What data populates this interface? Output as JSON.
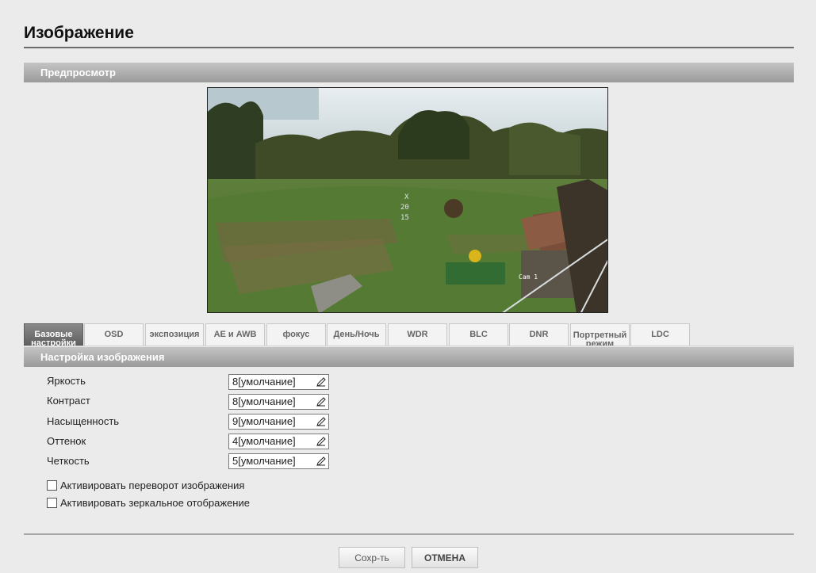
{
  "page": {
    "title": "Изображение"
  },
  "preview": {
    "section_title": "Предпросмотр",
    "overlay_text": "Cam 1"
  },
  "tabs": [
    {
      "label": "Базовые настройки",
      "active": true
    },
    {
      "label": "OSD",
      "active": false
    },
    {
      "label": "экспозиция",
      "active": false
    },
    {
      "label": "AE и AWB",
      "active": false
    },
    {
      "label": "фокус",
      "active": false
    },
    {
      "label": "День/Ночь",
      "active": false
    },
    {
      "label": "WDR",
      "active": false
    },
    {
      "label": "BLC",
      "active": false
    },
    {
      "label": "DNR",
      "active": false
    },
    {
      "label": "Портретный режим",
      "active": false
    },
    {
      "label": "LDC",
      "active": false
    }
  ],
  "image_settings": {
    "section_title": "Настройка изображения",
    "rows": [
      {
        "label": "Яркость",
        "value": "8[умолчание]"
      },
      {
        "label": "Контраст",
        "value": "8[умолчание]"
      },
      {
        "label": "Насыщенность",
        "value": "9[умолчание]"
      },
      {
        "label": "Оттенок",
        "value": "4[умолчание]"
      },
      {
        "label": "Четкость",
        "value": "5[умолчание]"
      }
    ],
    "edit_icon": "pencil-icon"
  },
  "options": {
    "flip": {
      "label": "Активировать переворот изображения",
      "checked": false
    },
    "mirror": {
      "label": "Активировать зеркальное отображение",
      "checked": false
    }
  },
  "buttons": {
    "save": "Сохр-ть",
    "cancel": "ОТМЕНА"
  }
}
